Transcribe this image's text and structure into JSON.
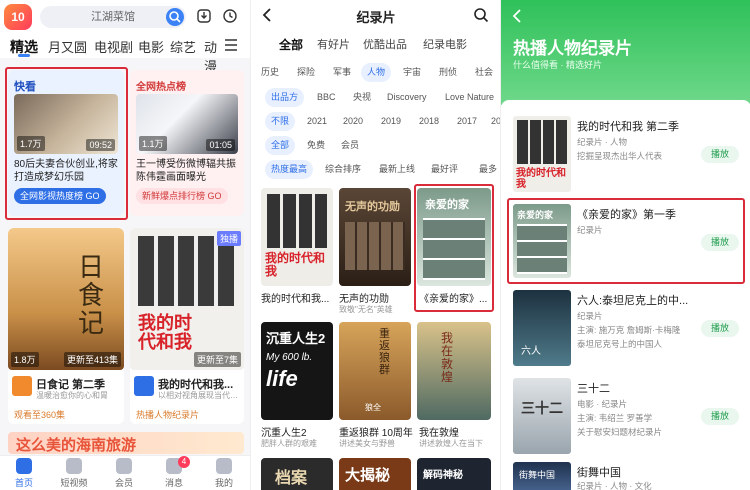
{
  "panel1": {
    "logo": "10",
    "search_placeholder": "江湖菜馆",
    "tabs": [
      "精选",
      "月又圆",
      "电视剧",
      "电影",
      "综艺",
      "动漫"
    ],
    "card1": {
      "tag": "快看",
      "duration": "09:52",
      "views": "1.7万",
      "title": "80后夫妻合伙创业,将家打造成梦幻乐园",
      "pill": "全网影视热度榜 GO"
    },
    "card2": {
      "tag": "全网热点榜",
      "duration": "01:05",
      "views": "1.1万",
      "title": "王一博受伤微博辐共振 陈伟霆画面曝光",
      "pill": "新鲜爆点排行榜 GO"
    },
    "card3": {
      "poster": "日食记",
      "views": "1.8万",
      "ep": "更新至413集",
      "title": "日食记 第二季",
      "sub": "温暖治愈你的心和胃",
      "more": "观看至360集"
    },
    "card4": {
      "badge": "独播",
      "poster": "我的时代和我",
      "ep": "更新至7集",
      "title": "我的时代和我...",
      "sub": "以相对视角展现当代中华人代表",
      "more": "热播人物纪录片"
    },
    "bottom_banner": "这么美的海南旅游",
    "nav": [
      "首页",
      "短视频",
      "会员",
      "消息",
      "我的"
    ],
    "nav_badge": "4"
  },
  "panel2": {
    "title": "纪录片",
    "tabs": [
      "全部",
      "有好片",
      "优酷出品",
      "纪录电影"
    ],
    "row1": [
      "历史",
      "探险",
      "军事",
      "人物",
      "宇宙",
      "刑侦",
      "社会"
    ],
    "row2": [
      "出品方",
      "BBC",
      "央视",
      "Discovery",
      "Love Nature"
    ],
    "row3": [
      "不限",
      "2021",
      "2020",
      "2019",
      "2018",
      "2017",
      "20"
    ],
    "row4": [
      "全部",
      "免费",
      "会员"
    ],
    "row5": [
      "热度最高",
      "综合排序",
      "最新上线",
      "最好评",
      "最多"
    ],
    "items": [
      {
        "title": "我的时代和我...",
        "sub": "",
        "poster": "我的时代和我"
      },
      {
        "title": "无声的功勋",
        "sub": "致敬\"无名\"英雄",
        "poster": "无声的功勋"
      },
      {
        "title": "《亲爱的家》...",
        "sub": "",
        "poster": "亲爱的家"
      },
      {
        "title": "沉重人生2",
        "sub": "肥胖人群的艰难",
        "poster": "沉重人生2"
      },
      {
        "title": "重返狼群 10周年",
        "sub": "讲述美女与野兽",
        "poster": "重返狼群"
      },
      {
        "title": "我在敦煌",
        "sub": "讲述敦煌人在当下",
        "poster": "我在敦煌"
      },
      {
        "title": "",
        "sub": "",
        "poster": "档案"
      },
      {
        "title": "",
        "sub": "",
        "poster": "大揭秘"
      },
      {
        "title": "",
        "sub": "",
        "poster": "解码神秘"
      }
    ],
    "item4_line2": "My 600 lb.",
    "item4_line3": "life",
    "item5_tag": "狼全",
    "item6_tag": "我在敦煌"
  },
  "panel3": {
    "title": "热播人物纪录片",
    "subtitle": "什么值得看 · 精选好片",
    "items": [
      {
        "title": "我的时代和我 第二季",
        "meta": "纪录片 · 人物",
        "desc": "挖掘呈现杰出华人代表",
        "play": "播放"
      },
      {
        "title": "《亲爱的家》第一季",
        "meta": "纪录片",
        "desc": "",
        "play": "播放"
      },
      {
        "title": "六人:泰坦尼克上的中...",
        "meta": "纪录片",
        "desc": "主演: 施万克 詹姆斯·卡梅隆",
        "desc2": "泰坦尼克号上的中国人",
        "play": "播放"
      },
      {
        "title": "三十二",
        "meta": "电影 · 纪录片",
        "desc": "主演: 韦绍兰 罗善学",
        "desc2": "关于慰安妇题材纪录片",
        "play": "播放"
      },
      {
        "title": "街舞中国",
        "meta": "纪录片 · 人物 · 文化",
        "desc": "",
        "play": "播放"
      }
    ],
    "poster_texts": [
      "我的时代和我",
      "亲爱的家",
      "六人",
      "三十二",
      "街舞中国"
    ]
  }
}
